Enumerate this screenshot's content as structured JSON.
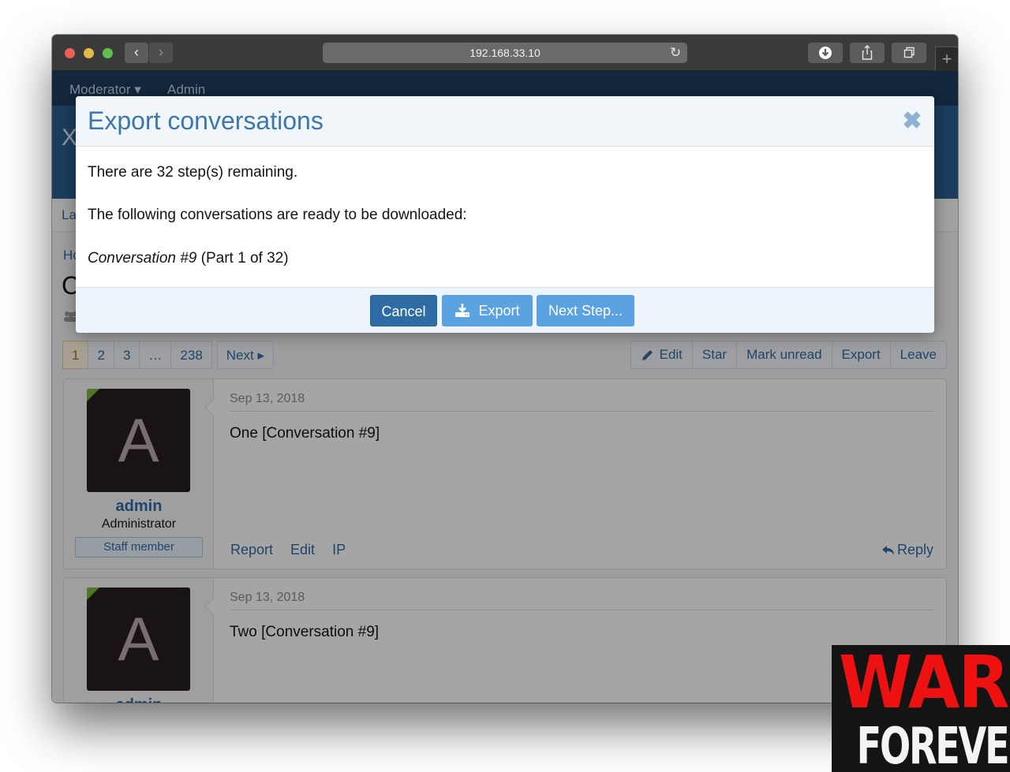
{
  "browser": {
    "url": "192.168.33.10",
    "new_tab_label": "+"
  },
  "page": {
    "topnav": [
      "Moderator ▾",
      "Admin"
    ],
    "logo_fragment": "X",
    "tab_fragment": "La",
    "breadcrumb_fragment": "Ho",
    "title_fragment": "C",
    "pagination": {
      "pages": [
        "1",
        "2",
        "3",
        "…",
        "238"
      ],
      "current": "1",
      "next_label": "Next ▸"
    },
    "actions": [
      "Edit",
      "Star",
      "Mark unread",
      "Export",
      "Leave"
    ],
    "messages": [
      {
        "avatar_letter": "A",
        "username": "admin",
        "user_title": "Administrator",
        "badge": "Staff member",
        "date": "Sep 13, 2018",
        "body": "One [Conversation #9]",
        "links": [
          "Report",
          "Edit",
          "IP"
        ],
        "reply_label": "Reply"
      },
      {
        "avatar_letter": "A",
        "username": "admin",
        "date": "Sep 13, 2018",
        "body": "Two [Conversation #9]"
      }
    ]
  },
  "modal": {
    "title": "Export conversations",
    "close_icon": "✖",
    "steps_remaining_text": "There are 32 step(s) remaining.",
    "ready_text": "The following conversations are ready to be downloaded:",
    "item_title": "Conversation #9",
    "item_part": " (Part 1 of 32)",
    "buttons": {
      "cancel": "Cancel",
      "export": "Export",
      "next": "Next Step..."
    }
  },
  "watermark": {
    "line1": "WAR",
    "line2": "FOREVER"
  }
}
